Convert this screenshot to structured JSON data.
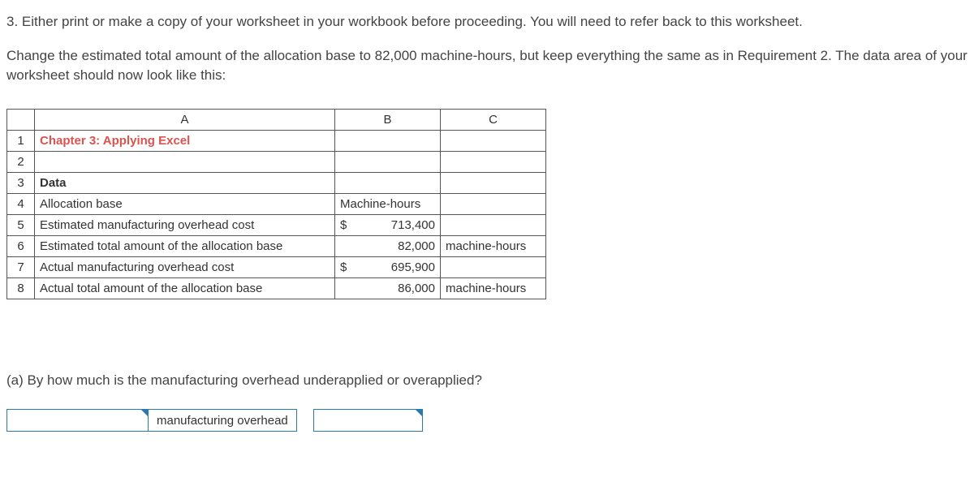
{
  "instructions": {
    "line1": "3. Either print or make a copy of your worksheet in your workbook before proceeding. You will need to refer back to this worksheet.",
    "line2": "Change the estimated total amount of the allocation base to 82,000 machine-hours, but keep everything the same as in Requirement 2. The data area of your worksheet should now look like this:"
  },
  "columns": {
    "a": "A",
    "b": "B",
    "c": "C"
  },
  "rows": {
    "r1": {
      "num": "1",
      "a": "Chapter 3: Applying Excel",
      "b": "",
      "c": ""
    },
    "r2": {
      "num": "2",
      "a": "",
      "b": "",
      "c": ""
    },
    "r3": {
      "num": "3",
      "a": "Data",
      "b": "",
      "c": ""
    },
    "r4": {
      "num": "4",
      "a": "Allocation base",
      "b": "Machine-hours",
      "c": ""
    },
    "r5": {
      "num": "5",
      "a": "Estimated manufacturing overhead cost",
      "b_symbol": "$",
      "b_value": "713,400",
      "c": ""
    },
    "r6": {
      "num": "6",
      "a": "Estimated total amount of the allocation base",
      "b_value": "82,000",
      "c": "machine-hours"
    },
    "r7": {
      "num": "7",
      "a": "Actual manufacturing overhead cost",
      "b_symbol": "$",
      "b_value": "695,900",
      "c": ""
    },
    "r8": {
      "num": "8",
      "a": "Actual total amount of the allocation base",
      "b_value": "86,000",
      "c": "machine-hours"
    }
  },
  "question": {
    "text": "(a) By how much is the manufacturing overhead underapplied or overapplied?",
    "label": "manufacturing overhead"
  }
}
